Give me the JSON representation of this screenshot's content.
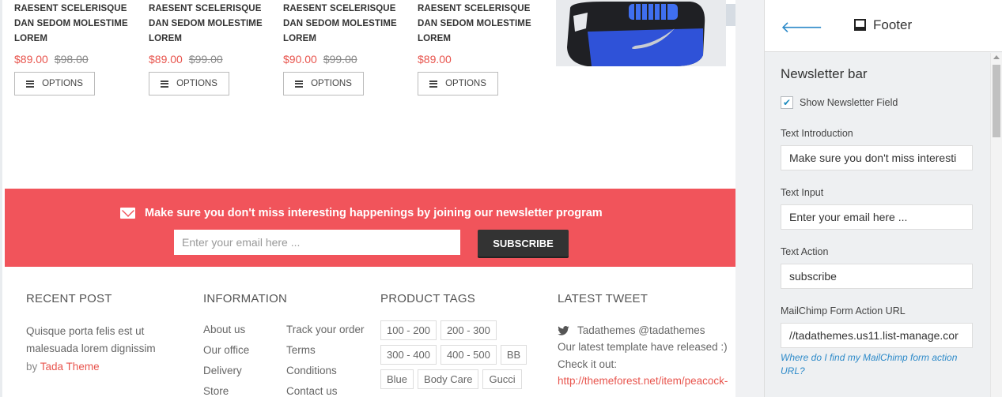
{
  "products": [
    {
      "title": "RAESENT SCELERISQUE DAN SEDOM MOLESTIME LOREM",
      "price": "$89.00",
      "old_price": "$98.00",
      "button": "OPTIONS"
    },
    {
      "title": "RAESENT SCELERISQUE DAN SEDOM MOLESTIME LOREM",
      "price": "$89.00",
      "old_price": "$99.00",
      "button": "OPTIONS"
    },
    {
      "title": "RAESENT SCELERISQUE DAN SEDOM MOLESTIME LOREM",
      "price": "$90.00",
      "old_price": "$99.00",
      "button": "OPTIONS"
    },
    {
      "title": "RAESENT SCELERISQUE DAN SEDOM MOLESTIME LOREM",
      "price": "$89.00",
      "old_price": "",
      "button": "OPTIONS"
    }
  ],
  "newsletter": {
    "text": "Make sure you don't miss interesting happenings by joining our newsletter program",
    "placeholder": "Enter your email here ...",
    "button": "SUBSCRIBE"
  },
  "footer": {
    "recent_post": {
      "heading": "RECENT POST",
      "text": "Quisque porta felis est ut malesuada lorem dignissim",
      "by": "by",
      "author": "Tada Theme"
    },
    "information": {
      "heading": "INFORMATION",
      "links": [
        "About us",
        "Track your order",
        "Our office",
        "Terms",
        "Delivery",
        "Conditions",
        "Store",
        "Contact us"
      ]
    },
    "product_tags": {
      "heading": "PRODUCT TAGS",
      "tags": [
        "100 - 200",
        "200 - 300",
        "300 - 400",
        "400 - 500",
        "BB",
        "Blue",
        "Body Care",
        "Gucci"
      ]
    },
    "latest_tweet": {
      "heading": "LATEST TWEET",
      "author": "Tadathemes @tadathemes",
      "body": "Our latest template have released :) Check it out:",
      "link": "http://themeforest.net/item/peacock-"
    }
  },
  "panel": {
    "title": "Footer",
    "section": "Newsletter bar",
    "checkbox_label": "Show Newsletter Field",
    "fields": [
      {
        "label": "Text Introduction",
        "value": "Make sure you don't miss interesti"
      },
      {
        "label": "Text Input",
        "value": "Enter your email here ..."
      },
      {
        "label": "Text Action",
        "value": "subscribe"
      },
      {
        "label": "MailChimp Form Action URL",
        "value": "//tadathemes.us11.list-manage.cor"
      }
    ],
    "help": "Where do I find my MailChimp form action URL?"
  },
  "colors": {
    "accent": "#f1545b",
    "link_blue": "#2d8ac9",
    "price_red": "#e8554e"
  }
}
